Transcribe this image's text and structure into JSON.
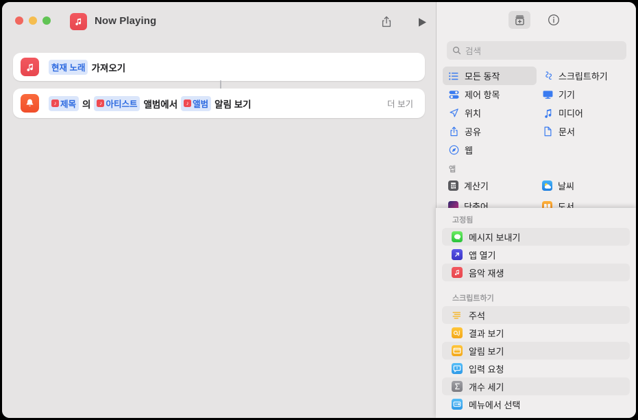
{
  "window": {
    "title": "Now Playing",
    "app_icon": "music-note-icon",
    "traffic_lights": [
      "close-button",
      "minimize-button",
      "maximize-button"
    ],
    "toolbar": {
      "share_label": "share-icon",
      "play_label": "play-icon"
    }
  },
  "workflow": {
    "actions": [
      {
        "icon": "music-app-icon",
        "tokens": [
          {
            "type": "pill",
            "text": "현재 노래"
          },
          {
            "type": "plain",
            "text": "가져오기"
          }
        ],
        "trailing": ""
      },
      {
        "icon": "alert-bell-icon",
        "tokens": [
          {
            "type": "pill",
            "text": "제목",
            "badge": "♪"
          },
          {
            "type": "plain",
            "text": "의"
          },
          {
            "type": "pill",
            "text": "아티스트",
            "badge": "♪"
          },
          {
            "type": "plain",
            "text": "앨범에서"
          },
          {
            "type": "pill",
            "text": "앨범",
            "badge": "♪"
          },
          {
            "type": "plain",
            "text": "알림 보기"
          }
        ],
        "trailing": "더 보기"
      }
    ]
  },
  "sidebar": {
    "tools": [
      {
        "name": "action-library-button",
        "icon": "library-add-icon",
        "selected": true
      },
      {
        "name": "info-button",
        "icon": "info-circle-icon",
        "selected": false
      }
    ],
    "search": {
      "placeholder": "검색",
      "value": "",
      "icon": "search-icon"
    },
    "categories": [
      {
        "label": "모든 동작",
        "icon": "list-bullet-icon",
        "selected": true
      },
      {
        "label": "스크립트하기",
        "icon": "scripting-icon",
        "selected": false
      },
      {
        "label": "제어 항목",
        "icon": "sliders-icon",
        "selected": false
      },
      {
        "label": "기기",
        "icon": "display-icon",
        "selected": false
      },
      {
        "label": "위치",
        "icon": "location-arrow-icon",
        "selected": false
      },
      {
        "label": "미디어",
        "icon": "music-note-icon",
        "selected": false
      },
      {
        "label": "공유",
        "icon": "share-up-icon",
        "selected": false
      },
      {
        "label": "문서",
        "icon": "document-icon",
        "selected": false
      },
      {
        "label": "웹",
        "icon": "safari-compass-icon",
        "selected": false
      }
    ],
    "apps_header": "앱",
    "apps": [
      {
        "label": "계산기",
        "icon": "calculator-icon",
        "color": "#8e8e93"
      },
      {
        "label": "날씨",
        "icon": "weather-icon",
        "color": "#3ba6f5"
      },
      {
        "label": "단축어",
        "icon": "shortcuts-icon",
        "color": "#d9318c"
      },
      {
        "label": "도서",
        "icon": "books-icon",
        "color": "#f5a623"
      }
    ]
  },
  "overlay": {
    "sections": [
      {
        "header": "고정됨",
        "items": [
          {
            "label": "메시지 보내기",
            "icon": "messages-icon",
            "color": "#4cd964",
            "alt": true
          },
          {
            "label": "앱 열기",
            "icon": "open-app-icon",
            "color": "#4a47dd",
            "alt": false
          },
          {
            "label": "음악 재생",
            "icon": "music-play-icon",
            "color": "#ef4b52",
            "alt": true
          }
        ]
      },
      {
        "header": "스크립트하기",
        "items": [
          {
            "label": "주석",
            "icon": "comment-icon",
            "color": "#f5b932",
            "alt": true
          },
          {
            "label": "결과 보기",
            "icon": "quick-look-icon",
            "color": "#f5b932",
            "alt": false
          },
          {
            "label": "알림 보기",
            "icon": "show-alert-icon",
            "color": "#f5b932",
            "alt": true
          },
          {
            "label": "입력 요청",
            "icon": "ask-input-icon",
            "color": "#3ba6f5",
            "alt": false
          },
          {
            "label": "개수 세기",
            "icon": "count-icon",
            "color": "#8e8e93",
            "alt": true
          },
          {
            "label": "메뉴에서 선택",
            "icon": "choose-menu-icon",
            "color": "#3ba6f5",
            "alt": false
          }
        ]
      }
    ]
  }
}
